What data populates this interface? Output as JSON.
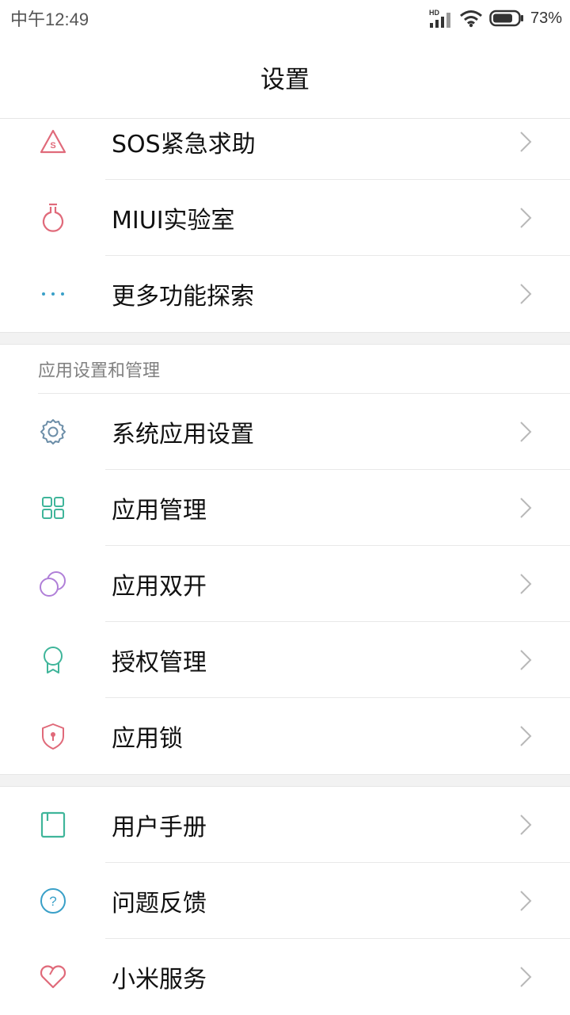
{
  "status_bar": {
    "time": "中午12:49",
    "signal_label": "HD",
    "battery_percent": "73%"
  },
  "header": {
    "title": "设置"
  },
  "group1": [
    {
      "label": "SOS紧急求助",
      "icon": "sos-icon",
      "color": "#e06a7a"
    },
    {
      "label": "MIUI实验室",
      "icon": "flask-icon",
      "color": "#e06a7a"
    },
    {
      "label": "更多功能探索",
      "icon": "more-dots-icon",
      "color": "#3aa0c8"
    }
  ],
  "section2": {
    "header": "应用设置和管理",
    "items": [
      {
        "label": "系统应用设置",
        "icon": "gear-icon",
        "color": "#6c8ea8"
      },
      {
        "label": "应用管理",
        "icon": "app-grid-icon",
        "color": "#3fb59a"
      },
      {
        "label": "应用双开",
        "icon": "dual-app-icon",
        "color": "#b07fd8"
      },
      {
        "label": "授权管理",
        "icon": "badge-icon",
        "color": "#3fb59a"
      },
      {
        "label": "应用锁",
        "icon": "lock-shield-icon",
        "color": "#e06a7a"
      }
    ]
  },
  "group3": [
    {
      "label": "用户手册",
      "icon": "manual-icon",
      "color": "#3fb59a"
    },
    {
      "label": "问题反馈",
      "icon": "help-icon",
      "color": "#3aa0c8"
    },
    {
      "label": "小米服务",
      "icon": "heart-icon",
      "color": "#e06a7a"
    }
  ]
}
